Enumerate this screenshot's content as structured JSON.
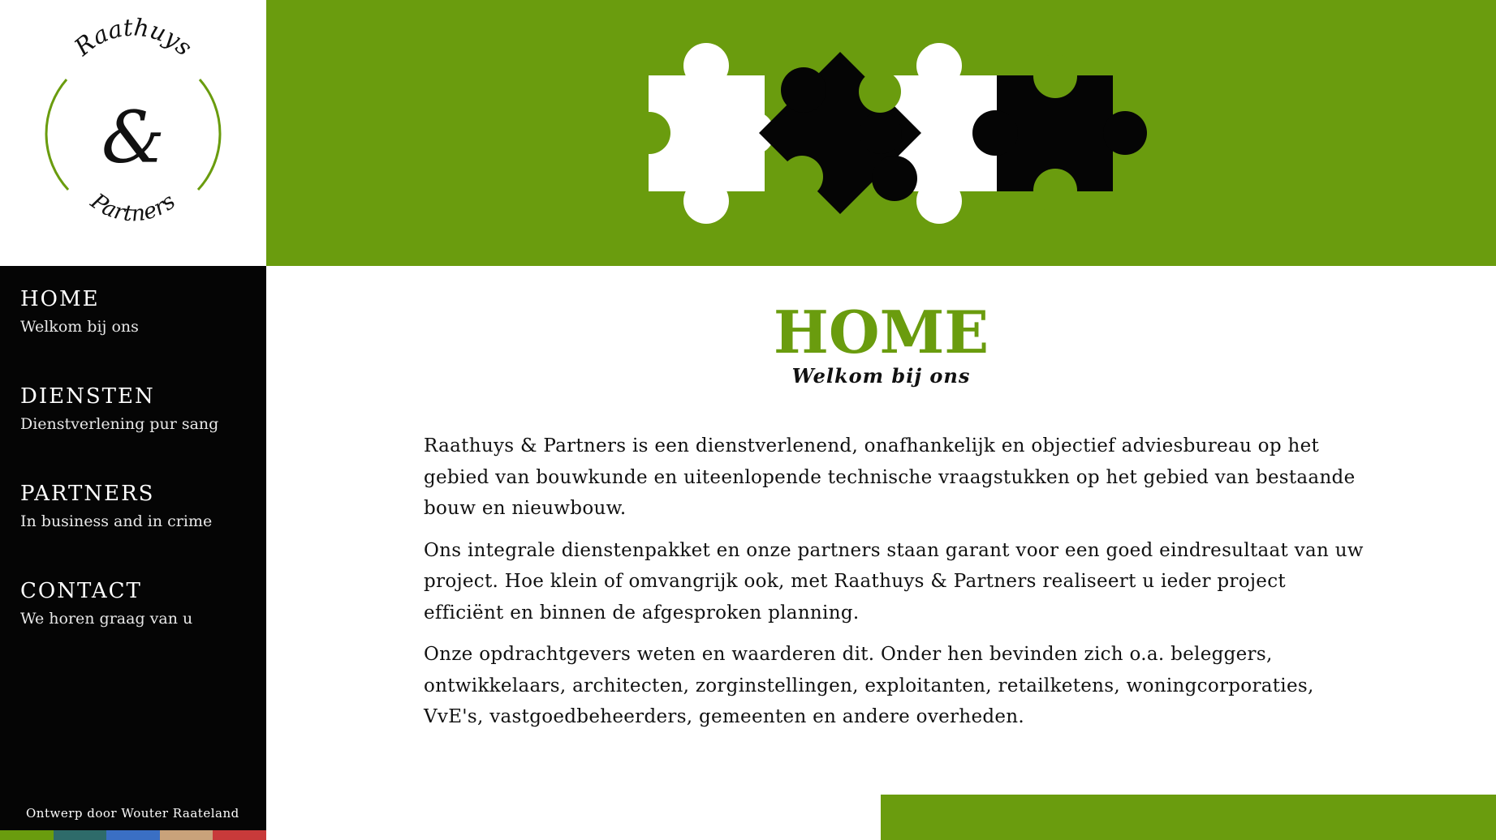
{
  "logo": {
    "top_text": "Raathuys",
    "ampersand": "&",
    "bottom_text": "Partners"
  },
  "nav": [
    {
      "title": "HOME",
      "subtitle": "Welkom bij ons"
    },
    {
      "title": "DIENSTEN",
      "subtitle": "Dienstverlening pur sang"
    },
    {
      "title": "PARTNERS",
      "subtitle": "In business and in crime"
    },
    {
      "title": "CONTACT",
      "subtitle": "We horen graag van u"
    }
  ],
  "footer": {
    "credit": "Ontwerp door Wouter Raateland",
    "stripe_colors": [
      "#6a9c0e",
      "#2e6b6a",
      "#3a6fc4",
      "#c9a27a",
      "#c83a3a"
    ]
  },
  "page": {
    "title": "HOME",
    "subtitle": "Welkom bij ons",
    "paragraphs": [
      "Raathuys & Partners is een dienstverlenend, onafhankelijk en objectief adviesbureau op het gebied van bouwkunde en uiteenlopende technische vraagstukken op het gebied van bestaande bouw en nieuwbouw.",
      "Ons integrale dienstenpakket en onze partners staan garant voor een goed eindresultaat van uw project. Hoe klein of omvangrijk ook, met Raathuys & Partners realiseert u ieder project efficiënt en binnen de afgesproken planning.",
      "Onze opdrachtgevers weten en waarderen dit. Onder hen bevinden zich o.a. beleggers, ontwikkelaars, architecten, zorginstellingen, exploitanten, retailketens, woningcorporaties, VvE's, vastgoedbeheerders, gemeenten en andere overheden."
    ]
  },
  "colors": {
    "accent": "#6a9c0e",
    "sidebar": "#050505",
    "text": "#111111"
  },
  "icons": [
    "puzzle-pieces-illustration"
  ]
}
